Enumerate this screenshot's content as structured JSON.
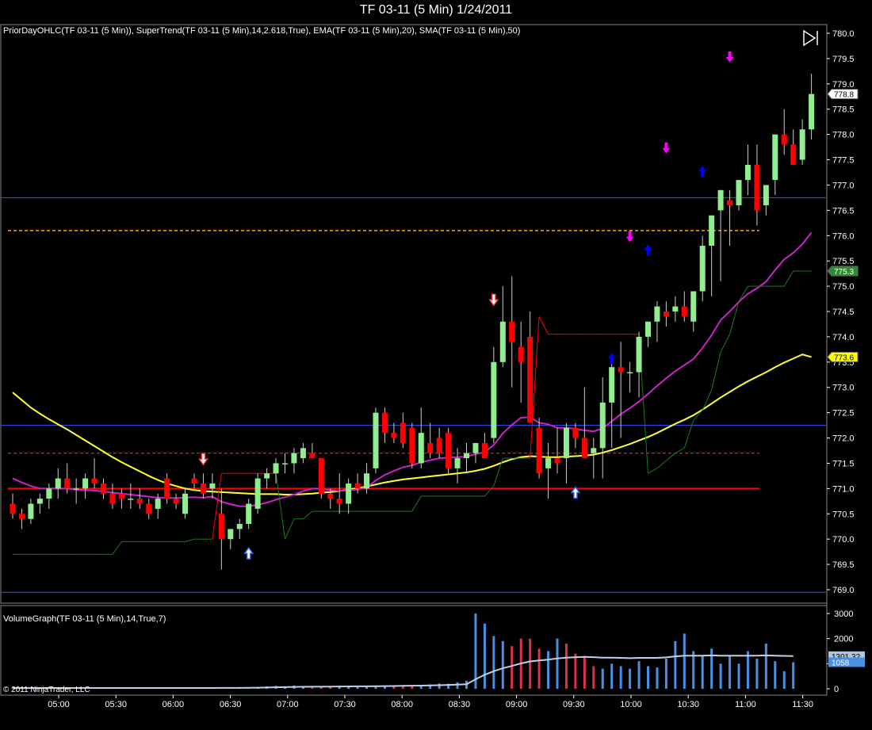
{
  "window": {
    "title": "TF 03-11 (5 Min)  1/24/2011",
    "copyright": "© 2011 NinjaTrader, LLC",
    "play_button_icon": "play-to-end-icon"
  },
  "price_panel": {
    "indicator_label": "PriorDayOHLC(TF 03-11 (5 Min)), SuperTrend(TF 03-11 (5 Min),14,2.618,True), EMA(TF 03-11 (5 Min),20), SMA(TF 03-11 (5 Min),50)",
    "price_ticks": [
      "780.0",
      "779.5",
      "779.0",
      "778.5",
      "778.0",
      "777.5",
      "777.0",
      "776.5",
      "776.0",
      "775.5",
      "775.0",
      "774.5",
      "774.0",
      "773.5",
      "773.0",
      "772.5",
      "772.0",
      "771.5",
      "771.0",
      "770.5",
      "770.0",
      "769.5",
      "769.0"
    ],
    "tags": [
      {
        "label": "778.8",
        "value": 778.8,
        "bg": "#ffffff",
        "fg": "#000000"
      },
      {
        "label": "775.3",
        "value": 775.3,
        "bg": "#2e8b2e",
        "fg": "#ffffff"
      },
      {
        "label": "773.6",
        "value": 773.6,
        "bg": "#ffff00",
        "fg": "#000000"
      }
    ]
  },
  "volume_panel": {
    "indicator_label": "VolumeGraph(TF 03-11 (5 Min),14,True,7)",
    "volume_ticks": [
      "3000",
      "2000",
      "1000",
      "0"
    ],
    "tags": [
      {
        "label": "1301.32",
        "value": 1301.32,
        "bg": "#b0c4de",
        "fg": "#000000"
      },
      {
        "label": "1058",
        "value": 1058,
        "bg": "#4a90e2",
        "fg": "#ffffff"
      }
    ]
  },
  "time_axis": {
    "ticks": [
      "05:00",
      "05:30",
      "06:00",
      "06:30",
      "07:00",
      "07:30",
      "08:00",
      "08:30",
      "09:00",
      "09:30",
      "10:00",
      "10:30",
      "11:00",
      "11:30"
    ]
  },
  "colors": {
    "up": "#90ee90",
    "down": "#ff0000",
    "ema": "#cc22cc",
    "sma": "#ffff33",
    "supertrend_up": "#1f7a1f",
    "supertrend_down": "#ff0000",
    "prior_close": "#ff0000",
    "prior_open": "#ff3333",
    "prior_high_low": "#3355ff",
    "orange_level": "#ffa500",
    "vol_up": "#4a90e2",
    "vol_down": "#e0304a",
    "vol_avg": "#c0d0e8"
  },
  "chart_data": {
    "type": "candlestick",
    "title": "TF 03-11 (5 Min)  1/24/2011",
    "ylim": [
      768.8,
      780.1
    ],
    "yticks": [
      780.0,
      779.5,
      779.0,
      778.5,
      778.0,
      777.5,
      777.0,
      776.5,
      776.0,
      775.5,
      775.0,
      774.5,
      774.0,
      773.5,
      773.0,
      772.5,
      772.0,
      771.5,
      771.0,
      770.5,
      770.0,
      769.5,
      769.0
    ],
    "levels": [
      {
        "name": "prior_high",
        "value": 776.75,
        "style": "solid",
        "color": "#3355ff"
      },
      {
        "name": "orange",
        "value": 776.1,
        "style": "dashed",
        "color": "#ffa500"
      },
      {
        "name": "prior_upper",
        "value": 772.25,
        "style": "solid",
        "color": "#3355ff"
      },
      {
        "name": "prior_open",
        "value": 771.7,
        "style": "dashed",
        "color": "#ff3333"
      },
      {
        "name": "prior_close",
        "value": 771.0,
        "style": "solid",
        "color": "#ff0000"
      },
      {
        "name": "prior_low",
        "value": 768.95,
        "style": "solid",
        "color": "#3355ff"
      }
    ],
    "candles": [
      [
        770.7,
        770.9,
        770.4,
        770.5
      ],
      [
        770.5,
        770.6,
        770.2,
        770.4
      ],
      [
        770.4,
        770.8,
        770.3,
        770.7
      ],
      [
        770.7,
        770.9,
        770.5,
        770.8
      ],
      [
        770.8,
        771.1,
        770.6,
        771.0
      ],
      [
        771.0,
        771.4,
        770.8,
        771.2
      ],
      [
        771.2,
        771.5,
        770.9,
        771.0
      ],
      [
        771.0,
        771.2,
        770.7,
        771.0
      ],
      [
        771.0,
        771.3,
        770.8,
        771.2
      ],
      [
        771.2,
        771.6,
        771.0,
        771.1
      ],
      [
        771.1,
        771.2,
        770.8,
        770.9
      ],
      [
        770.9,
        771.1,
        770.6,
        770.7
      ],
      [
        770.9,
        771.0,
        770.6,
        770.8
      ],
      [
        770.8,
        771.1,
        770.6,
        770.8
      ],
      [
        770.8,
        771.0,
        770.6,
        770.7
      ],
      [
        770.7,
        770.8,
        770.4,
        770.5
      ],
      [
        770.6,
        770.9,
        770.4,
        770.8
      ],
      [
        771.2,
        771.3,
        770.7,
        770.8
      ],
      [
        770.8,
        770.9,
        770.6,
        770.7
      ],
      [
        770.5,
        771.0,
        770.4,
        770.9
      ],
      [
        771.2,
        771.3,
        771.0,
        771.1
      ],
      [
        771.1,
        771.3,
        770.8,
        770.9
      ],
      [
        771.0,
        771.3,
        770.8,
        771.1
      ],
      [
        770.5,
        771.0,
        769.4,
        770.0
      ],
      [
        770.0,
        770.2,
        769.8,
        770.2
      ],
      [
        770.2,
        770.4,
        770.0,
        770.3
      ],
      [
        770.3,
        770.8,
        770.2,
        770.7
      ],
      [
        770.6,
        771.3,
        770.5,
        771.2
      ],
      [
        771.2,
        771.4,
        771.0,
        771.3
      ],
      [
        771.3,
        771.6,
        771.1,
        771.5
      ],
      [
        771.5,
        771.7,
        771.3,
        771.5
      ],
      [
        771.5,
        771.8,
        771.3,
        771.7
      ],
      [
        771.6,
        771.9,
        771.5,
        771.8
      ],
      [
        771.7,
        771.9,
        771.6,
        771.6
      ],
      [
        771.6,
        771.6,
        770.8,
        770.9
      ],
      [
        770.9,
        771.0,
        770.6,
        770.8
      ],
      [
        770.8,
        771.3,
        770.5,
        770.7
      ],
      [
        770.7,
        771.2,
        770.5,
        771.1
      ],
      [
        771.1,
        771.3,
        770.9,
        771.0
      ],
      [
        771.0,
        771.5,
        770.9,
        771.3
      ],
      [
        771.4,
        772.6,
        771.3,
        772.5
      ],
      [
        772.5,
        772.6,
        771.9,
        772.1
      ],
      [
        772.1,
        772.3,
        771.9,
        772.0
      ],
      [
        772.3,
        772.5,
        771.8,
        771.9
      ],
      [
        772.2,
        772.3,
        771.4,
        771.5
      ],
      [
        771.5,
        772.6,
        771.4,
        772.1
      ],
      [
        771.9,
        772.3,
        771.6,
        771.7
      ],
      [
        772.0,
        772.2,
        771.6,
        771.7
      ],
      [
        772.1,
        772.2,
        771.3,
        771.4
      ],
      [
        771.4,
        771.8,
        771.1,
        771.6
      ],
      [
        771.6,
        771.9,
        771.3,
        771.7
      ],
      [
        771.7,
        771.9,
        771.5,
        771.9
      ],
      [
        771.9,
        772.1,
        771.6,
        771.6
      ],
      [
        772.0,
        773.8,
        771.9,
        773.5
      ],
      [
        773.5,
        775.0,
        773.4,
        774.3
      ],
      [
        774.3,
        775.2,
        773.0,
        773.9
      ],
      [
        773.8,
        774.3,
        772.7,
        773.5
      ],
      [
        774.0,
        774.5,
        772.3,
        772.3
      ],
      [
        772.2,
        772.4,
        771.2,
        771.3
      ],
      [
        771.4,
        771.9,
        770.8,
        771.6
      ],
      [
        771.6,
        772.2,
        771.3,
        771.5
      ],
      [
        771.6,
        772.3,
        771.1,
        772.2
      ],
      [
        772.2,
        772.3,
        771.8,
        772.0
      ],
      [
        772.0,
        773.0,
        771.9,
        771.6
      ],
      [
        771.7,
        772.0,
        771.2,
        771.8
      ],
      [
        771.8,
        773.2,
        771.2,
        772.7
      ],
      [
        772.7,
        773.5,
        771.8,
        773.4
      ],
      [
        773.4,
        773.9,
        772.0,
        773.3
      ],
      [
        773.3,
        773.5,
        772.9,
        773.3
      ],
      [
        773.3,
        774.1,
        772.8,
        774.0
      ],
      [
        774.0,
        774.3,
        773.8,
        774.3
      ],
      [
        774.3,
        774.7,
        773.9,
        774.6
      ],
      [
        774.5,
        774.7,
        774.2,
        774.4
      ],
      [
        774.5,
        774.8,
        774.3,
        774.6
      ],
      [
        774.6,
        774.9,
        774.3,
        774.4
      ],
      [
        774.3,
        774.9,
        774.1,
        774.9
      ],
      [
        774.9,
        776.0,
        774.7,
        775.8
      ],
      [
        775.8,
        776.4,
        774.8,
        776.4
      ],
      [
        776.5,
        776.9,
        775.1,
        776.9
      ],
      [
        776.7,
        776.9,
        775.8,
        776.6
      ],
      [
        776.6,
        777.1,
        776.5,
        777.1
      ],
      [
        777.1,
        777.8,
        776.8,
        777.4
      ],
      [
        777.4,
        777.8,
        776.2,
        776.5
      ],
      [
        776.6,
        776.9,
        776.4,
        777.0
      ],
      [
        777.1,
        778.0,
        776.8,
        778.0
      ],
      [
        778.0,
        778.5,
        777.6,
        777.8
      ],
      [
        777.8,
        778.1,
        777.4,
        777.4
      ],
      [
        777.5,
        778.3,
        777.4,
        778.1
      ],
      [
        778.1,
        779.2,
        777.9,
        778.8
      ]
    ],
    "ema": [
      771.2,
      771.12,
      771.05,
      771.0,
      771.0,
      771.0,
      771.0,
      770.98,
      770.97,
      770.96,
      770.94,
      770.92,
      770.9,
      770.88,
      770.86,
      770.84,
      770.82,
      770.82,
      770.81,
      770.82,
      770.83,
      770.82,
      770.84,
      770.74,
      770.69,
      770.65,
      770.65,
      770.68,
      770.72,
      770.78,
      770.83,
      770.88,
      770.95,
      771.0,
      770.99,
      770.97,
      770.95,
      770.97,
      770.98,
      771.02,
      771.16,
      771.27,
      771.35,
      771.42,
      771.46,
      771.52,
      771.56,
      771.6,
      771.61,
      771.62,
      771.63,
      771.68,
      771.72,
      771.86,
      772.09,
      772.26,
      772.4,
      772.41,
      772.3,
      772.27,
      772.2,
      772.2,
      772.18,
      772.15,
      772.13,
      772.19,
      772.33,
      772.47,
      772.59,
      772.72,
      772.87,
      773.03,
      773.18,
      773.32,
      773.44,
      773.56,
      773.78,
      774.03,
      774.33,
      774.5,
      774.69,
      774.85,
      774.96,
      775.09,
      775.32,
      775.53,
      775.66,
      775.83,
      776.06
    ],
    "sma": [
      772.9,
      772.75,
      772.6,
      772.48,
      772.37,
      772.27,
      772.17,
      772.06,
      771.95,
      771.84,
      771.73,
      771.62,
      771.52,
      771.43,
      771.34,
      771.25,
      771.17,
      771.1,
      771.05,
      771.0,
      770.97,
      770.95,
      770.94,
      770.93,
      770.92,
      770.91,
      770.9,
      770.89,
      770.89,
      770.89,
      770.88,
      770.88,
      770.89,
      770.9,
      770.92,
      770.93,
      770.95,
      770.98,
      771.01,
      771.04,
      771.08,
      771.12,
      771.15,
      771.18,
      771.2,
      771.22,
      771.24,
      771.26,
      771.28,
      771.3,
      771.32,
      771.35,
      771.39,
      771.45,
      771.52,
      771.58,
      771.62,
      771.64,
      771.63,
      771.62,
      771.62,
      771.63,
      771.64,
      771.65,
      771.67,
      771.71,
      771.76,
      771.82,
      771.88,
      771.95,
      772.02,
      772.1,
      772.19,
      772.28,
      772.36,
      772.45,
      772.56,
      772.68,
      772.8,
      772.91,
      773.02,
      773.12,
      773.21,
      773.3,
      773.4,
      773.49,
      773.57,
      773.65,
      773.6
    ],
    "supertrend": [
      769.7,
      769.7,
      769.7,
      769.7,
      769.7,
      769.7,
      769.7,
      769.7,
      769.7,
      769.7,
      769.7,
      769.7,
      769.95,
      769.95,
      769.95,
      769.95,
      769.95,
      769.95,
      769.95,
      769.95,
      770.0,
      770.0,
      770.0,
      771.3,
      771.3,
      771.3,
      771.3,
      771.3,
      771.3,
      771.3,
      770.0,
      770.4,
      770.4,
      770.55,
      770.55,
      770.55,
      770.55,
      770.55,
      770.55,
      770.55,
      770.55,
      770.55,
      770.55,
      770.55,
      770.55,
      770.85,
      770.85,
      770.85,
      770.85,
      770.85,
      770.85,
      770.85,
      770.85,
      771.05,
      771.6,
      771.6,
      771.6,
      771.6,
      774.4,
      774.05,
      774.05,
      774.05,
      774.05,
      774.05,
      774.05,
      774.05,
      774.05,
      774.05,
      774.05,
      774.05,
      771.3,
      771.4,
      771.55,
      771.7,
      771.8,
      772.35,
      772.55,
      772.95,
      773.7,
      774.05,
      774.7,
      775.0,
      775.0,
      775.0,
      775.0,
      775.0,
      775.3,
      775.3,
      775.3
    ],
    "supertrend_dir": [
      1,
      1,
      1,
      1,
      1,
      1,
      1,
      1,
      1,
      1,
      1,
      1,
      1,
      1,
      1,
      1,
      1,
      1,
      1,
      1,
      1,
      1,
      1,
      -1,
      -1,
      -1,
      -1,
      -1,
      -1,
      -1,
      1,
      1,
      1,
      1,
      1,
      1,
      1,
      1,
      1,
      1,
      1,
      1,
      1,
      1,
      1,
      1,
      1,
      1,
      1,
      1,
      1,
      1,
      1,
      1,
      1,
      1,
      1,
      1,
      -1,
      -1,
      -1,
      -1,
      -1,
      -1,
      -1,
      -1,
      -1,
      -1,
      -1,
      -1,
      1,
      1,
      1,
      1,
      1,
      1,
      1,
      1,
      1,
      1,
      1,
      1,
      1,
      1,
      1,
      1,
      1,
      1,
      1
    ],
    "arrows": [
      {
        "bar": 21,
        "price": 771.55,
        "type": "down",
        "color": "#ff4444",
        "style": "outline"
      },
      {
        "bar": 26,
        "price": 769.75,
        "type": "up",
        "color": "#3366ff",
        "style": "outline"
      },
      {
        "bar": 53,
        "price": 774.7,
        "type": "down",
        "color": "#ff4444",
        "style": "outline"
      },
      {
        "bar": 62,
        "price": 770.95,
        "type": "up",
        "color": "#3366ff",
        "style": "outline"
      },
      {
        "bar": 66,
        "price": 773.6,
        "type": "up",
        "color": "#0000ff",
        "style": "solid"
      },
      {
        "bar": 68,
        "price": 775.95,
        "type": "down",
        "color": "#ff00ff",
        "style": "solid"
      },
      {
        "bar": 70,
        "price": 775.75,
        "type": "up",
        "color": "#0000ff",
        "style": "solid"
      },
      {
        "bar": 72,
        "price": 777.7,
        "type": "down",
        "color": "#ff00ff",
        "style": "solid"
      },
      {
        "bar": 76,
        "price": 777.3,
        "type": "up",
        "color": "#0000ff",
        "style": "solid"
      },
      {
        "bar": 79,
        "price": 779.5,
        "type": "down",
        "color": "#ff00ff",
        "style": "solid"
      }
    ],
    "volume": {
      "ylim": [
        0,
        3100
      ],
      "yticks": [
        3000,
        2000,
        1000,
        0
      ],
      "bars": [
        30,
        25,
        40,
        35,
        30,
        35,
        30,
        25,
        30,
        35,
        30,
        25,
        35,
        30,
        25,
        30,
        35,
        30,
        25,
        30,
        35,
        30,
        35,
        60,
        40,
        45,
        55,
        60,
        100,
        120,
        90,
        130,
        110,
        90,
        85,
        100,
        110,
        95,
        120,
        100,
        115,
        125,
        130,
        140,
        120,
        150,
        170,
        210,
        200,
        260,
        320,
        3000,
        2600,
        2100,
        1900,
        1700,
        2000,
        2000,
        1600,
        1500,
        2000,
        1800,
        1400,
        1300,
        900,
        800,
        1000,
        900,
        800,
        1100,
        900,
        850,
        1200,
        1900,
        2200,
        1500,
        1300,
        1600,
        1000,
        1300,
        1000,
        1500,
        1200,
        1800,
        1100,
        700,
        1058
      ],
      "bar_dir": [
        1,
        -1,
        1,
        1,
        1,
        1,
        -1,
        -1,
        1,
        -1,
        -1,
        -1,
        -1,
        1,
        1,
        -1,
        1,
        -1,
        -1,
        1,
        1,
        -1,
        1,
        -1,
        1,
        1,
        1,
        1,
        1,
        1,
        1,
        1,
        1,
        -1,
        -1,
        -1,
        1,
        1,
        1,
        1,
        1,
        1,
        -1,
        -1,
        -1,
        1,
        1,
        1,
        1,
        1,
        1,
        1,
        1,
        1,
        1,
        -1,
        -1,
        -1,
        -1,
        1,
        1,
        -1,
        -1,
        -1,
        -1,
        1,
        1,
        1,
        1,
        1,
        1,
        1,
        1,
        1,
        1,
        1,
        1,
        1,
        1,
        1,
        1,
        1,
        1,
        1,
        1,
        1,
        1
      ],
      "average": [
        30,
        29,
        30,
        31,
        31,
        31,
        31,
        30,
        31,
        32,
        31,
        30,
        31,
        31,
        30,
        30,
        31,
        31,
        30,
        30,
        31,
        31,
        32,
        35,
        36,
        37,
        39,
        42,
        50,
        60,
        67,
        75,
        80,
        82,
        84,
        88,
        92,
        94,
        98,
        100,
        104,
        108,
        112,
        118,
        122,
        128,
        134,
        144,
        152,
        166,
        182,
        380,
        560,
        700,
        820,
        910,
        1010,
        1090,
        1130,
        1160,
        1210,
        1240,
        1260,
        1270,
        1260,
        1240,
        1240,
        1230,
        1220,
        1230,
        1230,
        1230,
        1250,
        1290,
        1320,
        1320,
        1320,
        1330,
        1320,
        1320,
        1320,
        1320,
        1320,
        1330,
        1320,
        1310,
        1301.32
      ]
    }
  }
}
